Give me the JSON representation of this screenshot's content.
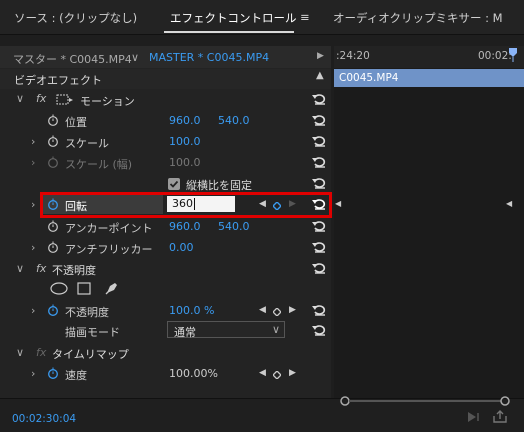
{
  "tabs": {
    "source": "ソース : (クリップなし)",
    "effect_controls": "エフェクトコントロール",
    "menu_glyph": "≡",
    "audio_mixer": "オーディオクリップミキサー : M"
  },
  "subtabs": {
    "master": "マスター * C0045.MP4",
    "chevron": "∨",
    "sequence": "MASTER * C0045.MP4",
    "play": "▶"
  },
  "timeline": {
    "start": ":24:20",
    "end": "00:02:",
    "clip": "C0045.MP4"
  },
  "video_effects": "ビデオエフェクト",
  "motion": {
    "fx": "fx",
    "name": "モーション",
    "position": {
      "label": "位置",
      "x": "960.0",
      "y": "540.0"
    },
    "scale": {
      "label": "スケール",
      "value": "100.0"
    },
    "scale_width": {
      "label": "スケール (幅)",
      "value": "100.0"
    },
    "uniform": {
      "label": "縦横比を固定"
    },
    "rotation": {
      "label": "回転",
      "value": "360"
    },
    "anchor": {
      "label": "アンカーポイント",
      "x": "960.0",
      "y": "540.0"
    },
    "flicker": {
      "label": "アンチフリッカー",
      "value": "0.00"
    }
  },
  "opacity": {
    "fx": "fx",
    "name": "不透明度",
    "label": "不透明度",
    "value": "100.0 %",
    "blend_label": "描画モード",
    "blend_value": "通常"
  },
  "time_remap": {
    "fx": "fx",
    "name": "タイムリマップ",
    "speed_label": "速度",
    "speed_value": "100.00%"
  },
  "timecode": "00:02:30:04",
  "colors": {
    "accent": "#3a9bf1",
    "highlight": "#e00000",
    "clip": "#6f93c8"
  }
}
